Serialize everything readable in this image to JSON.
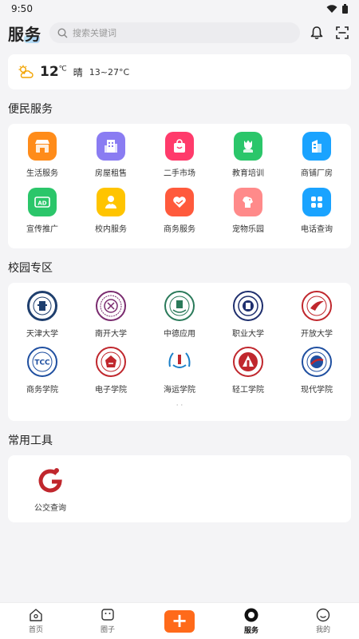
{
  "status": {
    "time": "9:50"
  },
  "header": {
    "title": "服务",
    "search_placeholder": "搜索关键词"
  },
  "weather": {
    "temp": "12",
    "unit": "℃",
    "condition": "晴",
    "range": "13~27°C"
  },
  "services": {
    "title": "便民服务",
    "items": [
      {
        "label": "生活服务",
        "icon": "shop-icon",
        "color": "#ff8c1a"
      },
      {
        "label": "房屋租售",
        "icon": "building-icon",
        "color": "#8a7cf2"
      },
      {
        "label": "二手市场",
        "icon": "shopping-bag-icon",
        "color": "#ff3b6b"
      },
      {
        "label": "教育培训",
        "icon": "tulip-icon",
        "color": "#2bc66a"
      },
      {
        "label": "商铺厂房",
        "icon": "office-icon",
        "color": "#1aa3ff"
      },
      {
        "label": "宣传推广",
        "icon": "ad-icon",
        "color": "#2bc66a"
      },
      {
        "label": "校内服务",
        "icon": "person-icon",
        "color": "#ffc400"
      },
      {
        "label": "商务服务",
        "icon": "heart-handshake-icon",
        "color": "#ff5a3c"
      },
      {
        "label": "宠物乐园",
        "icon": "dog-icon",
        "color": "#ff8a8a"
      },
      {
        "label": "电话查询",
        "icon": "apps-grid-icon",
        "color": "#1aa3ff"
      }
    ]
  },
  "campus": {
    "title": "校园专区",
    "items": [
      {
        "label": "天津大学",
        "icon": "tianjin-university-logo-icon",
        "color": "#1f3f6e"
      },
      {
        "label": "南开大学",
        "icon": "nankai-university-logo-icon",
        "color": "#7a2b6f"
      },
      {
        "label": "中德应用",
        "icon": "sino-german-logo-icon",
        "color": "#2a7a5a"
      },
      {
        "label": "职业大学",
        "icon": "vocational-university-logo-icon",
        "color": "#1f2f6e"
      },
      {
        "label": "开放大学",
        "icon": "open-university-logo-icon",
        "color": "#c0272d"
      },
      {
        "label": "商务学院",
        "icon": "business-college-logo-icon",
        "color": "#1f4fa0"
      },
      {
        "label": "电子学院",
        "icon": "electronics-college-logo-icon",
        "color": "#c0272d"
      },
      {
        "label": "海运学院",
        "icon": "maritime-college-logo-icon",
        "color": "#1a7fc8"
      },
      {
        "label": "轻工学院",
        "icon": "light-industry-college-logo-icon",
        "color": "#c0272d"
      },
      {
        "label": "现代学院",
        "icon": "modern-college-logo-icon",
        "color": "#1f4fa0"
      }
    ],
    "pager": "· ·"
  },
  "tools": {
    "title": "常用工具",
    "items": [
      {
        "label": "公交查询",
        "icon": "bus-query-icon",
        "color": "#c0272d"
      }
    ]
  },
  "tabbar": {
    "items": [
      {
        "label": "首页",
        "icon": "home-icon"
      },
      {
        "label": "圈子",
        "icon": "circle-chat-icon"
      },
      {
        "label": "",
        "icon": "plus-icon"
      },
      {
        "label": "服务",
        "icon": "service-icon",
        "active": true
      },
      {
        "label": "我的",
        "icon": "smile-icon"
      }
    ]
  }
}
